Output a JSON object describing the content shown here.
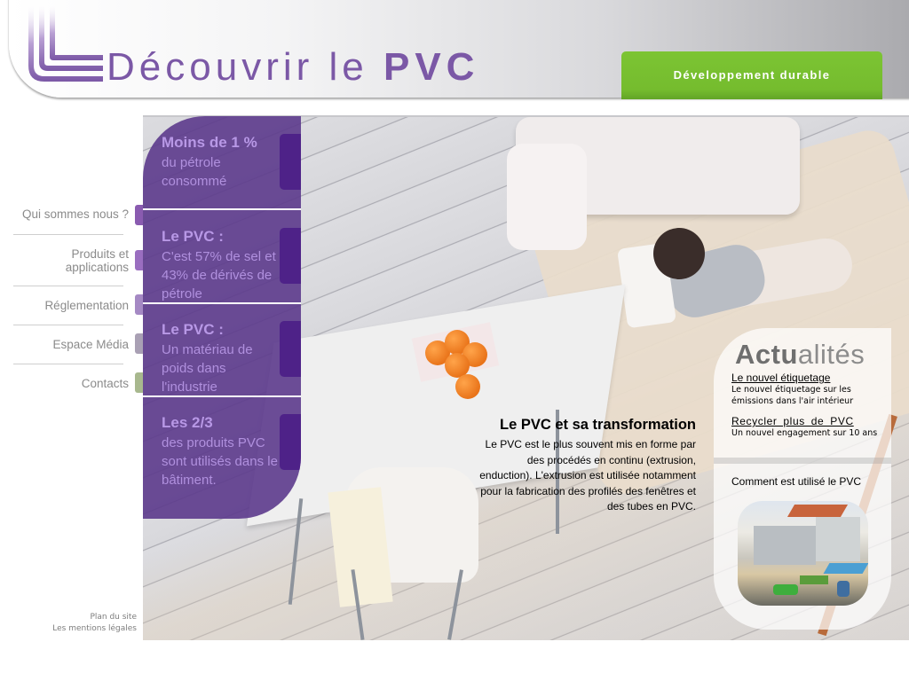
{
  "header": {
    "logo_text_regular": "Découvrir le",
    "logo_text_bold": "PVC",
    "top_button_label": "Développement durable",
    "accent_color": "#7b58a6",
    "button_color": "#7cc433"
  },
  "nav": {
    "items": [
      {
        "label": "Qui sommes nous ?",
        "color": "#8a5bb0"
      },
      {
        "label": "Produits et\napplications",
        "color": "#9a6ec0"
      },
      {
        "label": "Réglementation",
        "color": "#a589c4"
      },
      {
        "label": "Espace Média",
        "color": "#a9a0b4"
      },
      {
        "label": "Contacts",
        "color": "#a8b88e"
      }
    ]
  },
  "stats": [
    {
      "title": "Moins de 1 %",
      "description": "du pétrole consommé"
    },
    {
      "title": "Le PVC :",
      "description": "C'est 57% de sel et 43% de dérivés de pétrole"
    },
    {
      "title": "Le PVC :",
      "description": "Un matériau de poids dans l'industrie"
    },
    {
      "title": "Les 2/3",
      "description": "des produits PVC sont utilisés dans le bâtiment."
    }
  ],
  "article": {
    "heading": "Le PVC et sa transformation",
    "body": "Le PVC est le plus souvent mis en forme par des procédés en continu (extrusion, enduction). L'extrusion est utilisée notamment pour la fabrication des profilés des fenêtres et des tubes en PVC."
  },
  "news": {
    "title_bold": "Actu",
    "title_light": "alités",
    "items": [
      {
        "link": "Le nouvel étiquetage",
        "text": "Le nouvel étiquetage sur les émissions dans l'air intérieur"
      },
      {
        "link": "Recycler plus de PVC",
        "text": "Un nouvel engagement sur 10 ans"
      }
    ],
    "usage_title": "Comment est utilisé le PVC"
  },
  "footer": {
    "sitemap": "Plan du site",
    "legal": "Les mentions légales"
  }
}
